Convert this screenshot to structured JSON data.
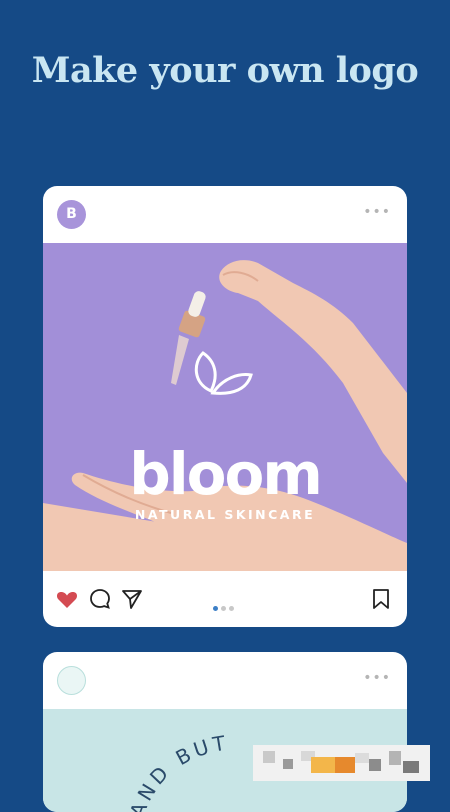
{
  "headline": "Make your own logo",
  "post1": {
    "avatar_initial": "B",
    "more_label": "•••",
    "brand_name": "bloom",
    "brand_tagline": "NATURAL SKINCARE",
    "carousel_total": 3,
    "carousel_active": 1,
    "background_color": "#a28fd8",
    "icons": [
      "heart-icon",
      "comment-icon",
      "share-icon",
      "bookmark-icon"
    ]
  },
  "post2": {
    "more_label": "•••",
    "curved_text": "AND BUT",
    "background_color": "#c8e5e6"
  },
  "colors": {
    "background": "#154a86",
    "headline": "#c9e6f2",
    "heart": "#d44b52"
  }
}
